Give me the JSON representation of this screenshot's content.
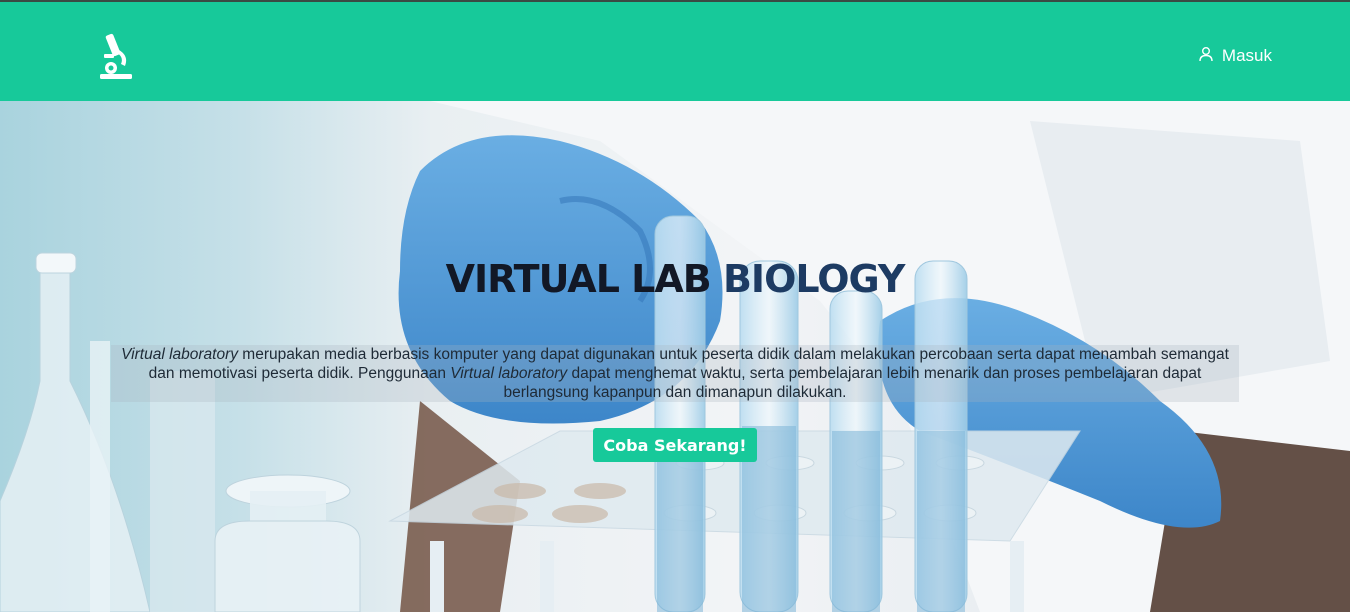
{
  "brand": {
    "logo_icon": "microscope-icon",
    "color": "#17c99a"
  },
  "nav": {
    "login_label": "Masuk",
    "login_icon": "user-icon"
  },
  "hero": {
    "title_part1": "VIRTUAL LAB ",
    "title_part2": "BIOLOGY",
    "desc_em1": "Virtual laboratory",
    "desc_text1": " merupakan media berbasis komputer yang dapat digunakan untuk peserta didik dalam melakukan percobaan serta dapat menambah semangat dan memotivasi peserta didik. Penggunaan ",
    "desc_em2": "Virtual laboratory",
    "desc_text2": " dapat menghemat waktu, serta pembelajaran lebih menarik dan proses pembelajaran dapat berlangsung kapanpun dan dimanapun dilakukan.",
    "cta_label": "Coba Sekarang!",
    "background": "laboratory test tubes photo"
  }
}
